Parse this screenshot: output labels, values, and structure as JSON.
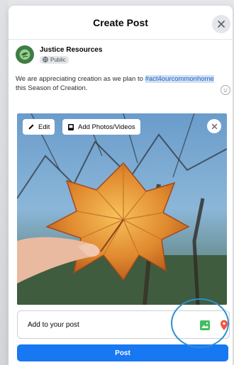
{
  "dialog": {
    "title": "Create Post"
  },
  "author": {
    "name": "Justice Resources",
    "privacy": "Public"
  },
  "caption": {
    "text_before": "We are appreciating creation as we plan to ",
    "hashtag": "#act4ourcommonhome",
    "text_after": " this Season of Creation."
  },
  "media": {
    "edit_label": "Edit",
    "add_media_label": "Add Photos/Videos"
  },
  "add_to_post": {
    "label": "Add to your post"
  },
  "post_button": {
    "label": "Post"
  },
  "colors": {
    "primary": "#1877f2",
    "hashtag_bg": "#cfe1f7",
    "highlight_ring": "#2b8fd6",
    "photo_icon": "#45bd62",
    "location_icon": "#f5533d"
  },
  "icons": [
    "close-icon",
    "globe-icon",
    "emoji-icon",
    "pencil-icon",
    "photo-stack-icon",
    "photo-icon",
    "location-pin-icon"
  ]
}
